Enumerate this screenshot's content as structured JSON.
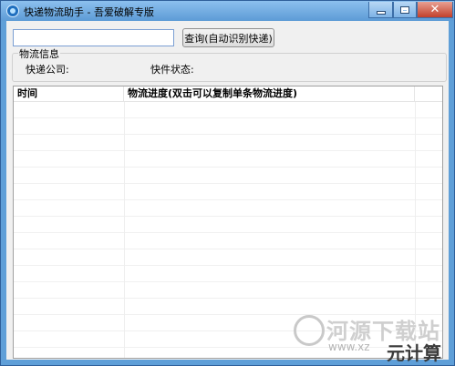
{
  "window": {
    "title": "快递物流助手 - 吾爱破解专版",
    "close_glyph": "✕"
  },
  "search": {
    "value": "",
    "query_button_label": "查询(自动识别快递)"
  },
  "info_group": {
    "title": "物流信息",
    "company_label": "快递公司:",
    "company_value": "",
    "status_label": "快件状态:",
    "status_value": ""
  },
  "table": {
    "columns": [
      "时间",
      "物流进度(双击可以复制单条物流进度)"
    ],
    "rows": []
  },
  "watermark": {
    "site_text": "河源下载站",
    "url_text": "www.xz",
    "brand_text": "元计算"
  }
}
